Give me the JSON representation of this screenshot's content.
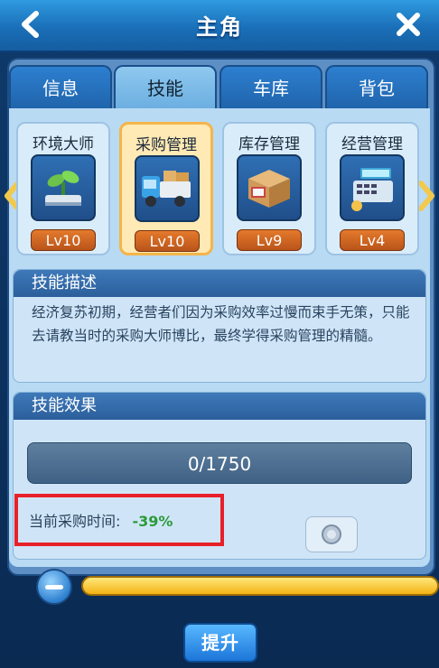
{
  "header": {
    "title": "主角",
    "back_icon": "chevron-left-icon",
    "close_icon": "close-icon"
  },
  "tabs": [
    {
      "label": "信息",
      "active": false
    },
    {
      "label": "技能",
      "active": true
    },
    {
      "label": "车库",
      "active": false
    },
    {
      "label": "背包",
      "active": false
    }
  ],
  "skills": [
    {
      "name": "环境大师",
      "level": "Lv10",
      "icon": "seedling-icon",
      "active": false
    },
    {
      "name": "采购管理",
      "level": "Lv10",
      "icon": "truck-icon",
      "active": true
    },
    {
      "name": "库存管理",
      "level": "Lv9",
      "icon": "box-icon",
      "active": false
    },
    {
      "name": "经营管理",
      "level": "Lv4",
      "icon": "cash-register-icon",
      "active": false
    }
  ],
  "description": {
    "title": "技能描述",
    "text": "经济复苏初期，经营者们因为采购效率过慢而束手无策，只能去请教当时的采购大师博比，最终学得采购管理的精髓。"
  },
  "effect": {
    "title": "技能效果",
    "progress": "0/1750",
    "label": "当前采购时间:",
    "value": "-39%"
  },
  "footer": {
    "upgrade_label": "提升"
  }
}
